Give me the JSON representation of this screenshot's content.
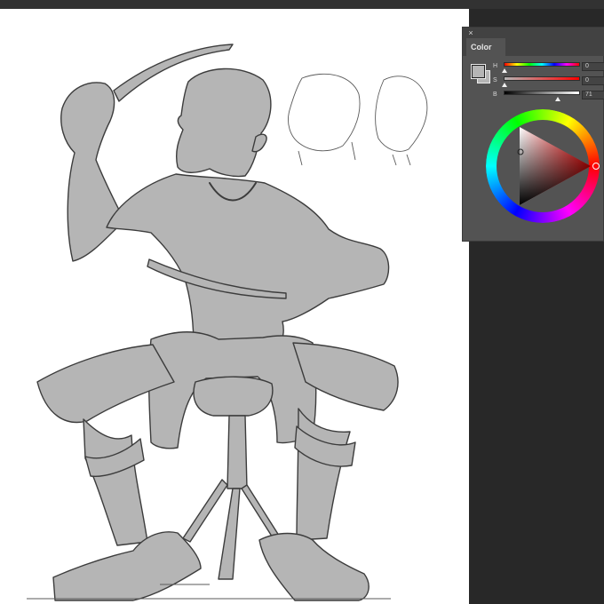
{
  "panel": {
    "close_glyph": "×",
    "tab_label": "Color",
    "foreground_color": "#b5b5b5",
    "background_color": "#b5b5b5"
  },
  "sliders": {
    "h": {
      "label": "H",
      "value": "0",
      "level": 0.0
    },
    "s": {
      "label": "S",
      "value": "0",
      "level": 0.0
    },
    "b": {
      "label": "B",
      "value": "71",
      "level": 0.71
    }
  },
  "canvas": {
    "description_icon": "character-sketch",
    "fill_color": "#b5b5b5"
  }
}
